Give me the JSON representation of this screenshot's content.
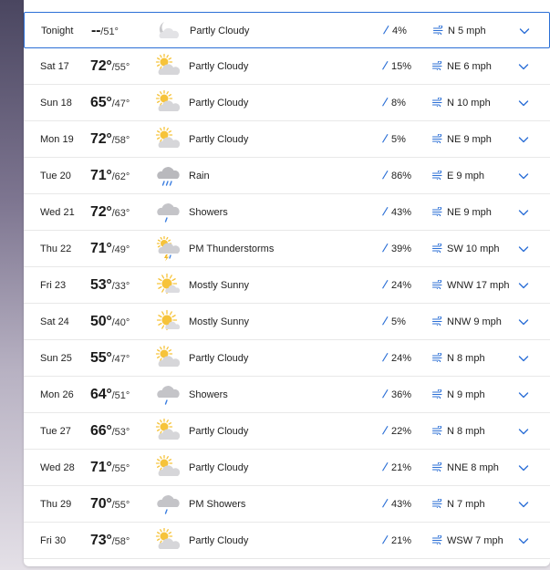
{
  "colors": {
    "accent": "#2b6fd6",
    "selected_border": "#2b6fd6",
    "divider": "#e8e8e8"
  },
  "forecast": [
    {
      "day": "Tonight",
      "high": "--",
      "low": "/51°",
      "icon": "cloud-moon-icon",
      "condition": "Partly Cloudy",
      "precip": "4%",
      "wind": "N 5 mph",
      "selected": true
    },
    {
      "day": "Sat 17",
      "high": "72°",
      "low": "/55°",
      "icon": "partly-cloudy-icon",
      "condition": "Partly Cloudy",
      "precip": "15%",
      "wind": "NE 6 mph"
    },
    {
      "day": "Sun 18",
      "high": "65°",
      "low": "/47°",
      "icon": "partly-cloudy-icon",
      "condition": "Partly Cloudy",
      "precip": "8%",
      "wind": "N 10 mph"
    },
    {
      "day": "Mon 19",
      "high": "72°",
      "low": "/58°",
      "icon": "partly-cloudy-icon",
      "condition": "Partly Cloudy",
      "precip": "5%",
      "wind": "NE 9 mph"
    },
    {
      "day": "Tue 20",
      "high": "71°",
      "low": "/62°",
      "icon": "rain-icon",
      "condition": "Rain",
      "precip": "86%",
      "wind": "E 9 mph"
    },
    {
      "day": "Wed 21",
      "high": "72°",
      "low": "/63°",
      "icon": "showers-icon",
      "condition": "Showers",
      "precip": "43%",
      "wind": "NE 9 mph"
    },
    {
      "day": "Thu 22",
      "high": "71°",
      "low": "/49°",
      "icon": "thunderstorm-icon",
      "condition": "PM Thunderstorms",
      "precip": "39%",
      "wind": "SW 10 mph"
    },
    {
      "day": "Fri 23",
      "high": "53°",
      "low": "/33°",
      "icon": "mostly-sunny-icon",
      "condition": "Mostly Sunny",
      "precip": "24%",
      "wind": "WNW 17 mph"
    },
    {
      "day": "Sat 24",
      "high": "50°",
      "low": "/40°",
      "icon": "mostly-sunny-icon",
      "condition": "Mostly Sunny",
      "precip": "5%",
      "wind": "NNW 9 mph"
    },
    {
      "day": "Sun 25",
      "high": "55°",
      "low": "/47°",
      "icon": "partly-cloudy-icon",
      "condition": "Partly Cloudy",
      "precip": "24%",
      "wind": "N 8 mph"
    },
    {
      "day": "Mon 26",
      "high": "64°",
      "low": "/51°",
      "icon": "showers-icon",
      "condition": "Showers",
      "precip": "36%",
      "wind": "N 9 mph"
    },
    {
      "day": "Tue 27",
      "high": "66°",
      "low": "/53°",
      "icon": "partly-cloudy-icon",
      "condition": "Partly Cloudy",
      "precip": "22%",
      "wind": "N 8 mph"
    },
    {
      "day": "Wed 28",
      "high": "71°",
      "low": "/55°",
      "icon": "partly-cloudy-icon",
      "condition": "Partly Cloudy",
      "precip": "21%",
      "wind": "NNE 8 mph"
    },
    {
      "day": "Thu 29",
      "high": "70°",
      "low": "/55°",
      "icon": "showers-icon",
      "condition": "PM Showers",
      "precip": "43%",
      "wind": "N 7 mph"
    },
    {
      "day": "Fri 30",
      "high": "73°",
      "low": "/58°",
      "icon": "partly-cloudy-icon",
      "condition": "Partly Cloudy",
      "precip": "21%",
      "wind": "WSW 7 mph"
    }
  ]
}
